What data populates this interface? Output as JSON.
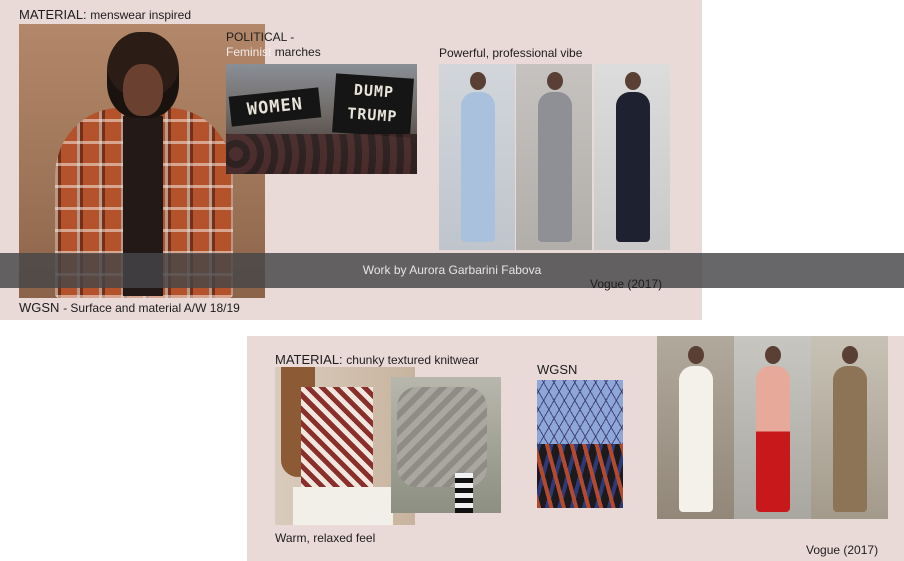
{
  "panel_top": {
    "material_label": "MATERIAL:",
    "material_text": "menswear inspired",
    "political_label": "POLITICAL -",
    "political_text_1": "Feminist",
    "political_text_2": "marches",
    "sign_left": "WOMEN",
    "sign_right": "DUMP TRUMP",
    "powerful_caption": "Powerful, professional vibe",
    "wgsn_label": "WGSN",
    "wgsn_text": "- Surface and material A/W 18/19",
    "vogue_credit": "Vogue (2017)"
  },
  "banner": {
    "text": "Work by Aurora Garbarini Fabova"
  },
  "panel_bottom": {
    "material_label": "MATERIAL:",
    "material_text": "chunky textured knitwear",
    "wgsn_label": "WGSN",
    "warm_caption": "Warm, relaxed feel",
    "vogue_credit": "Vogue (2017)"
  },
  "colors": {
    "panel_bg": "#e9d9d7",
    "banner_bg": "#464648"
  }
}
